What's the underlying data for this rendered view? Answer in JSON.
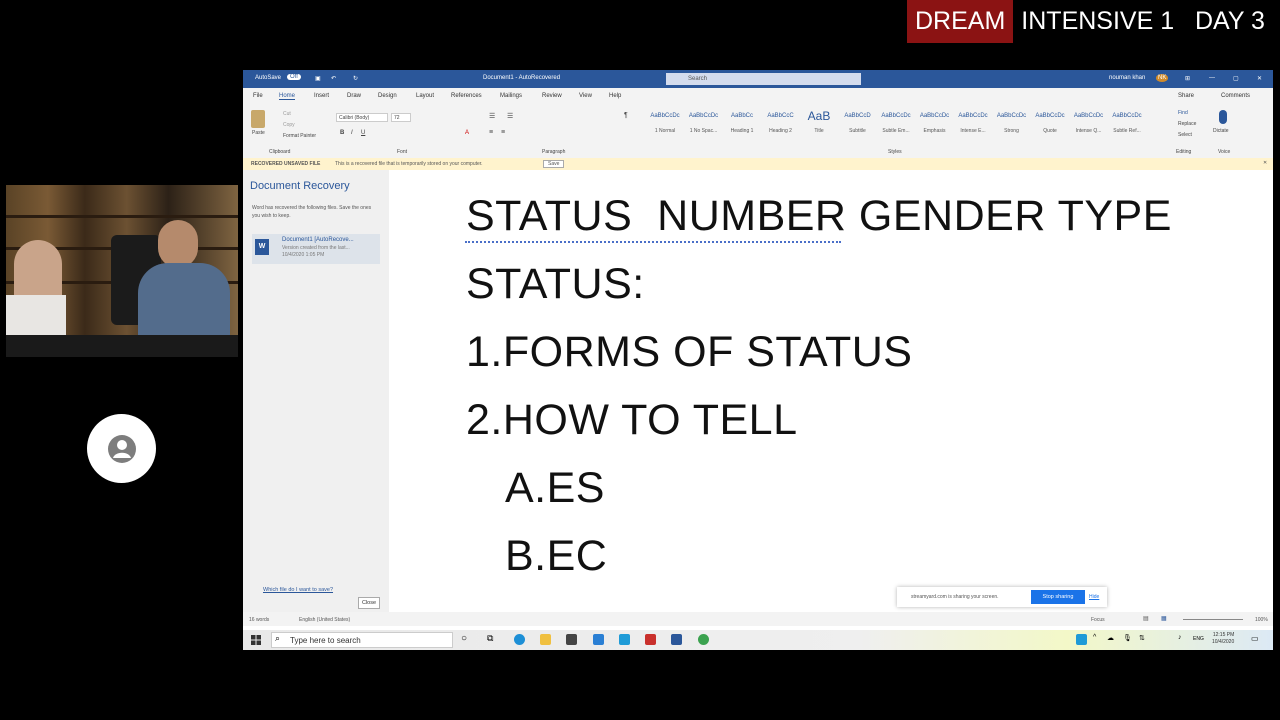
{
  "banner": {
    "dream": "DREAM",
    "rest": "INTENSIVE 1   DAY 3"
  },
  "word": {
    "titlebar": {
      "autosave": "AutoSave",
      "autosave_state": "Off",
      "doc_title": "Document1 - AutoRecovered",
      "search_placeholder": "Search",
      "user": "nouman khan",
      "user_initials": "NK"
    },
    "tabs": [
      "File",
      "Home",
      "Insert",
      "Draw",
      "Design",
      "Layout",
      "References",
      "Mailings",
      "Review",
      "View",
      "Help"
    ],
    "share_label": "Share",
    "comments_label": "Comments",
    "ribbon": {
      "paste": "Paste",
      "cut": "Cut",
      "copy": "Copy",
      "format_painter": "Format Painter",
      "font_name": "Calibri (Body)",
      "font_size": "72",
      "groups": [
        "Clipboard",
        "Font",
        "Paragraph",
        "Styles",
        "Editing",
        "Voice"
      ],
      "styles": [
        {
          "preview": "AaBbCcDc",
          "name": "1 Normal"
        },
        {
          "preview": "AaBbCcDc",
          "name": "1 No Spac..."
        },
        {
          "preview": "AaBbCc",
          "name": "Heading 1"
        },
        {
          "preview": "AaBbCcC",
          "name": "Heading 2"
        },
        {
          "preview": "AaB",
          "name": "Title"
        },
        {
          "preview": "AaBbCcD",
          "name": "Subtitle"
        },
        {
          "preview": "AaBbCcDc",
          "name": "Subtle Em..."
        },
        {
          "preview": "AaBbCcDc",
          "name": "Emphasis"
        },
        {
          "preview": "AaBbCcDc",
          "name": "Intense E..."
        },
        {
          "preview": "AaBbCcDc",
          "name": "Strong"
        },
        {
          "preview": "AaBbCcDc",
          "name": "Quote"
        },
        {
          "preview": "AaBbCcDc",
          "name": "Intense Q..."
        },
        {
          "preview": "AaBbCcDc",
          "name": "Subtle Ref..."
        }
      ],
      "find": "Find",
      "replace": "Replace",
      "select": "Select",
      "dictate": "Dictate"
    },
    "message_bar": {
      "label": "RECOVERED UNSAVED FILE",
      "text": "This is a recovered file that is temporarily stored on your computer.",
      "save": "Save"
    },
    "recovery": {
      "title": "Document Recovery",
      "text": "Word has recovered the following files. Save the ones you wish to keep.",
      "file_name": "Document1 [AutoRecove...",
      "file_desc": "Version created from the last...",
      "file_date": "10/4/2020 1:05 PM",
      "link": "Which file do I want to save?",
      "close": "Close"
    },
    "document": {
      "lines": [
        "STATUS  NUMBER GENDER TYPE",
        "STATUS:",
        "1.FORMS OF STATUS",
        "2.HOW TO TELL",
        "A.ES",
        "B.EC"
      ]
    },
    "screen_share": {
      "text": "streamyard.com is sharing your screen.",
      "stop": "Stop sharing",
      "hide": "Hide"
    },
    "statusbar": {
      "words": "16 words",
      "language": "English (United States)",
      "focus": "Focus",
      "zoom": "100%"
    }
  },
  "taskbar": {
    "search_placeholder": "Type here to search",
    "time": "12:15 PM",
    "date": "10/4/2020",
    "lang": "ENG"
  }
}
